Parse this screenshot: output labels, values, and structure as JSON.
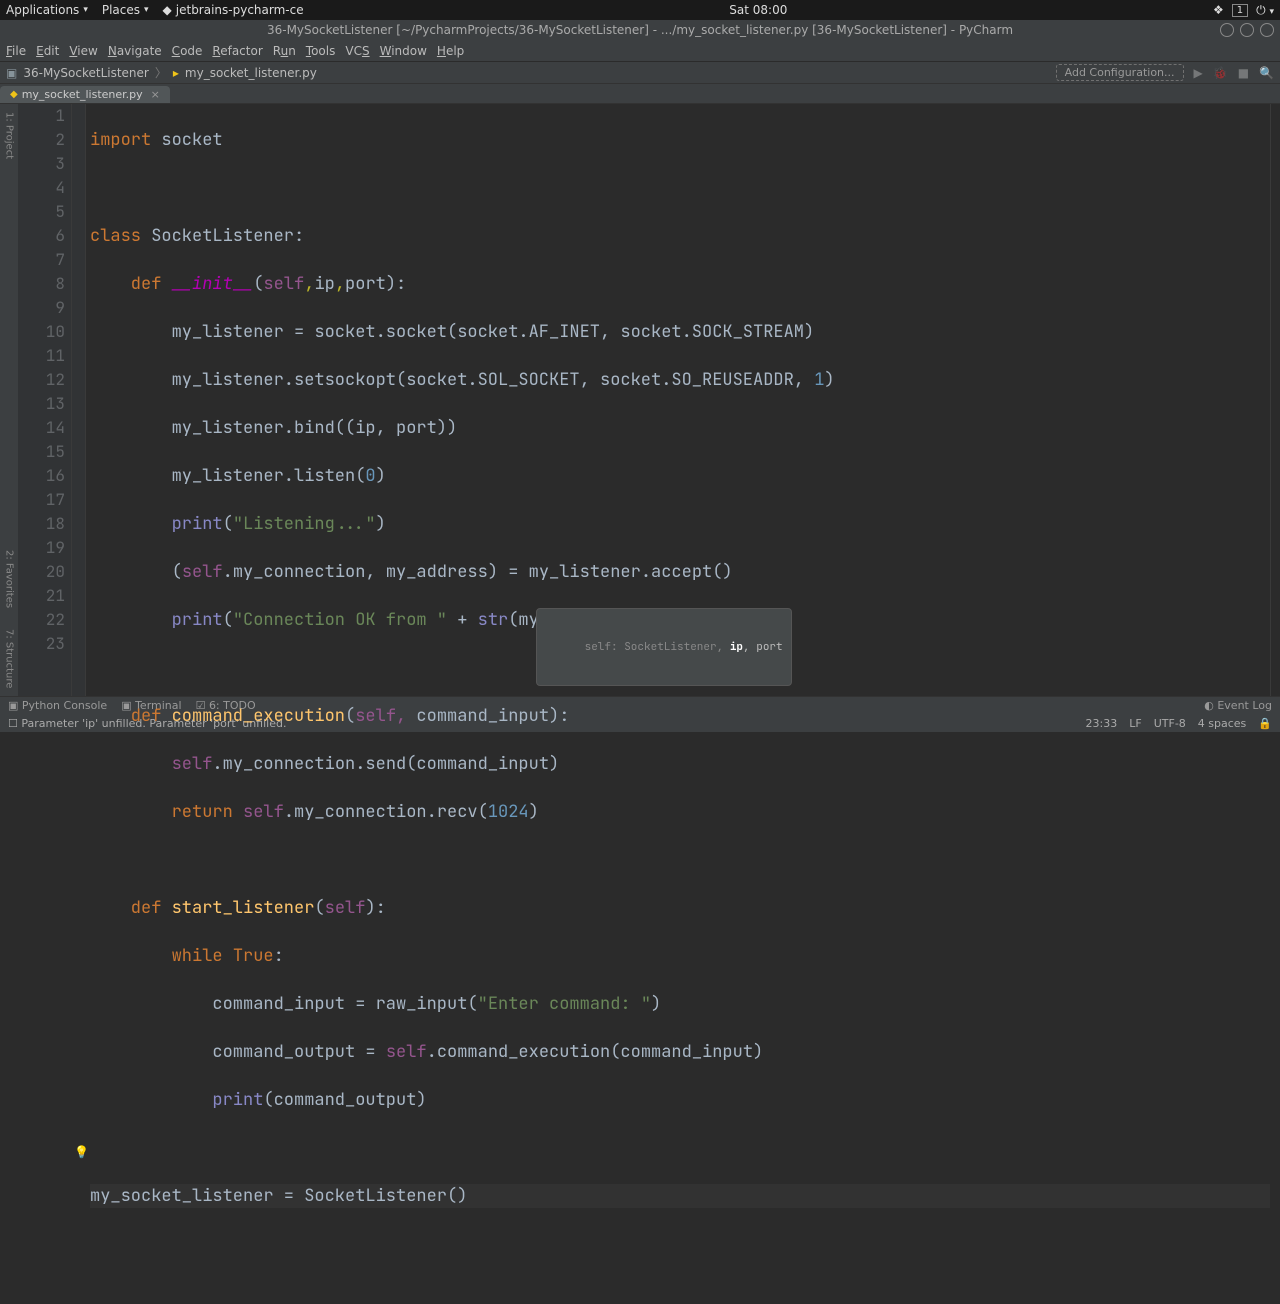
{
  "top_panel": {
    "apps": "Applications",
    "places": "Places",
    "app_name": "jetbrains-pycharm-ce",
    "clock": "Sat 08:00"
  },
  "window": {
    "title": "36-MySocketListener [~/PycharmProjects/36-MySocketListener] - .../my_socket_listener.py [36-MySocketListener] - PyCharm"
  },
  "menu": {
    "file": "File",
    "edit": "Edit",
    "view": "View",
    "navigate": "Navigate",
    "code": "Code",
    "refactor": "Refactor",
    "run": "Run",
    "tools": "Tools",
    "vcs": "VCS",
    "window": "Window",
    "help": "Help"
  },
  "nav": {
    "crumb1": "36-MySocketListener",
    "crumb2": "my_socket_listener.py",
    "add_config": "Add Configuration..."
  },
  "tab": {
    "name": "my_socket_listener.py"
  },
  "left_tools": {
    "project": "1: Project",
    "favorites": "2: Favorites",
    "structure": "7: Structure"
  },
  "hint": {
    "prefix": "self: SocketListener, ",
    "active": "ip",
    "rest": ", port"
  },
  "bottom": {
    "console": "Python Console",
    "terminal": "Terminal",
    "todo": "6: TODO",
    "eventlog": "Event Log"
  },
  "status": {
    "msg": "Parameter 'ip' unfilled. Parameter 'port' unfilled.",
    "pos": "23:33",
    "lf": "LF",
    "enc": "UTF-8",
    "spaces": "4 spaces"
  },
  "code": {
    "lines": [
      1,
      2,
      3,
      4,
      5,
      6,
      7,
      8,
      9,
      10,
      11,
      12,
      13,
      14,
      15,
      16,
      17,
      18,
      19,
      20,
      21,
      22,
      23
    ],
    "l1_import": "import",
    "l1_socket": " socket",
    "l3_class": "class",
    "l3_name": " SocketListener",
    "l3_colon": ":",
    "l4_def": "    def ",
    "l4_init": "__init__",
    "l4_p1": "(",
    "l4_self": "self",
    "l4_c1": ",",
    "l4_ip": "ip",
    "l4_c2": ",",
    "l4_port": "port",
    "l4_p2": "):",
    "l5": "        my_listener = socket.socket(socket.AF_INET, socket.SOCK_STREAM)",
    "l6a": "        my_listener.setsockopt(socket.SOL_SOCKET, socket.SO_REUSEADDR, ",
    "l6num": "1",
    "l6b": ")",
    "l7": "        my_listener.bind((ip, port))",
    "l8a": "        my_listener.listen(",
    "l8num": "0",
    "l8b": ")",
    "l9a": "        ",
    "l9print": "print",
    "l9b": "(",
    "l9str": "\"Listening...\"",
    "l9c": ")",
    "l10a": "        (",
    "l10self": "self",
    "l10b": ".my_connection, my_address) = my_listener.accept()",
    "l11a": "        ",
    "l11print": "print",
    "l11b": "(",
    "l11str": "\"Connection OK from \"",
    "l11c": " + ",
    "l11bi": "str",
    "l11d": "(my_address))",
    "l13_def": "    def ",
    "l13_name": "command_execution",
    "l13a": "(",
    "l13self": "self,",
    "l13b": " command_input):",
    "l14a": "        ",
    "l14self": "self",
    "l14b": ".my_connection.send(command_input)",
    "l15a": "        ",
    "l15ret": "return ",
    "l15self": "self",
    "l15b": ".my_connection.recv(",
    "l15num": "1024",
    "l15c": ")",
    "l17_def": "    def ",
    "l17_name": "start_listener",
    "l17a": "(",
    "l17self": "self",
    "l17b": "):",
    "l18a": "        ",
    "l18while": "while ",
    "l18true": "True",
    "l18b": ":",
    "l19a": "            command_input = ",
    "l19fn": "raw_input",
    "l19b": "(",
    "l19str": "\"Enter command: \"",
    "l19c": ")",
    "l20a": "            command_output = ",
    "l20self": "self",
    "l20b": ".command_execution(command_input)",
    "l21a": "            ",
    "l21print": "print",
    "l21b": "(command_output)",
    "l23a": "my_socket_listener = SocketListener(",
    "l23b": ")"
  }
}
